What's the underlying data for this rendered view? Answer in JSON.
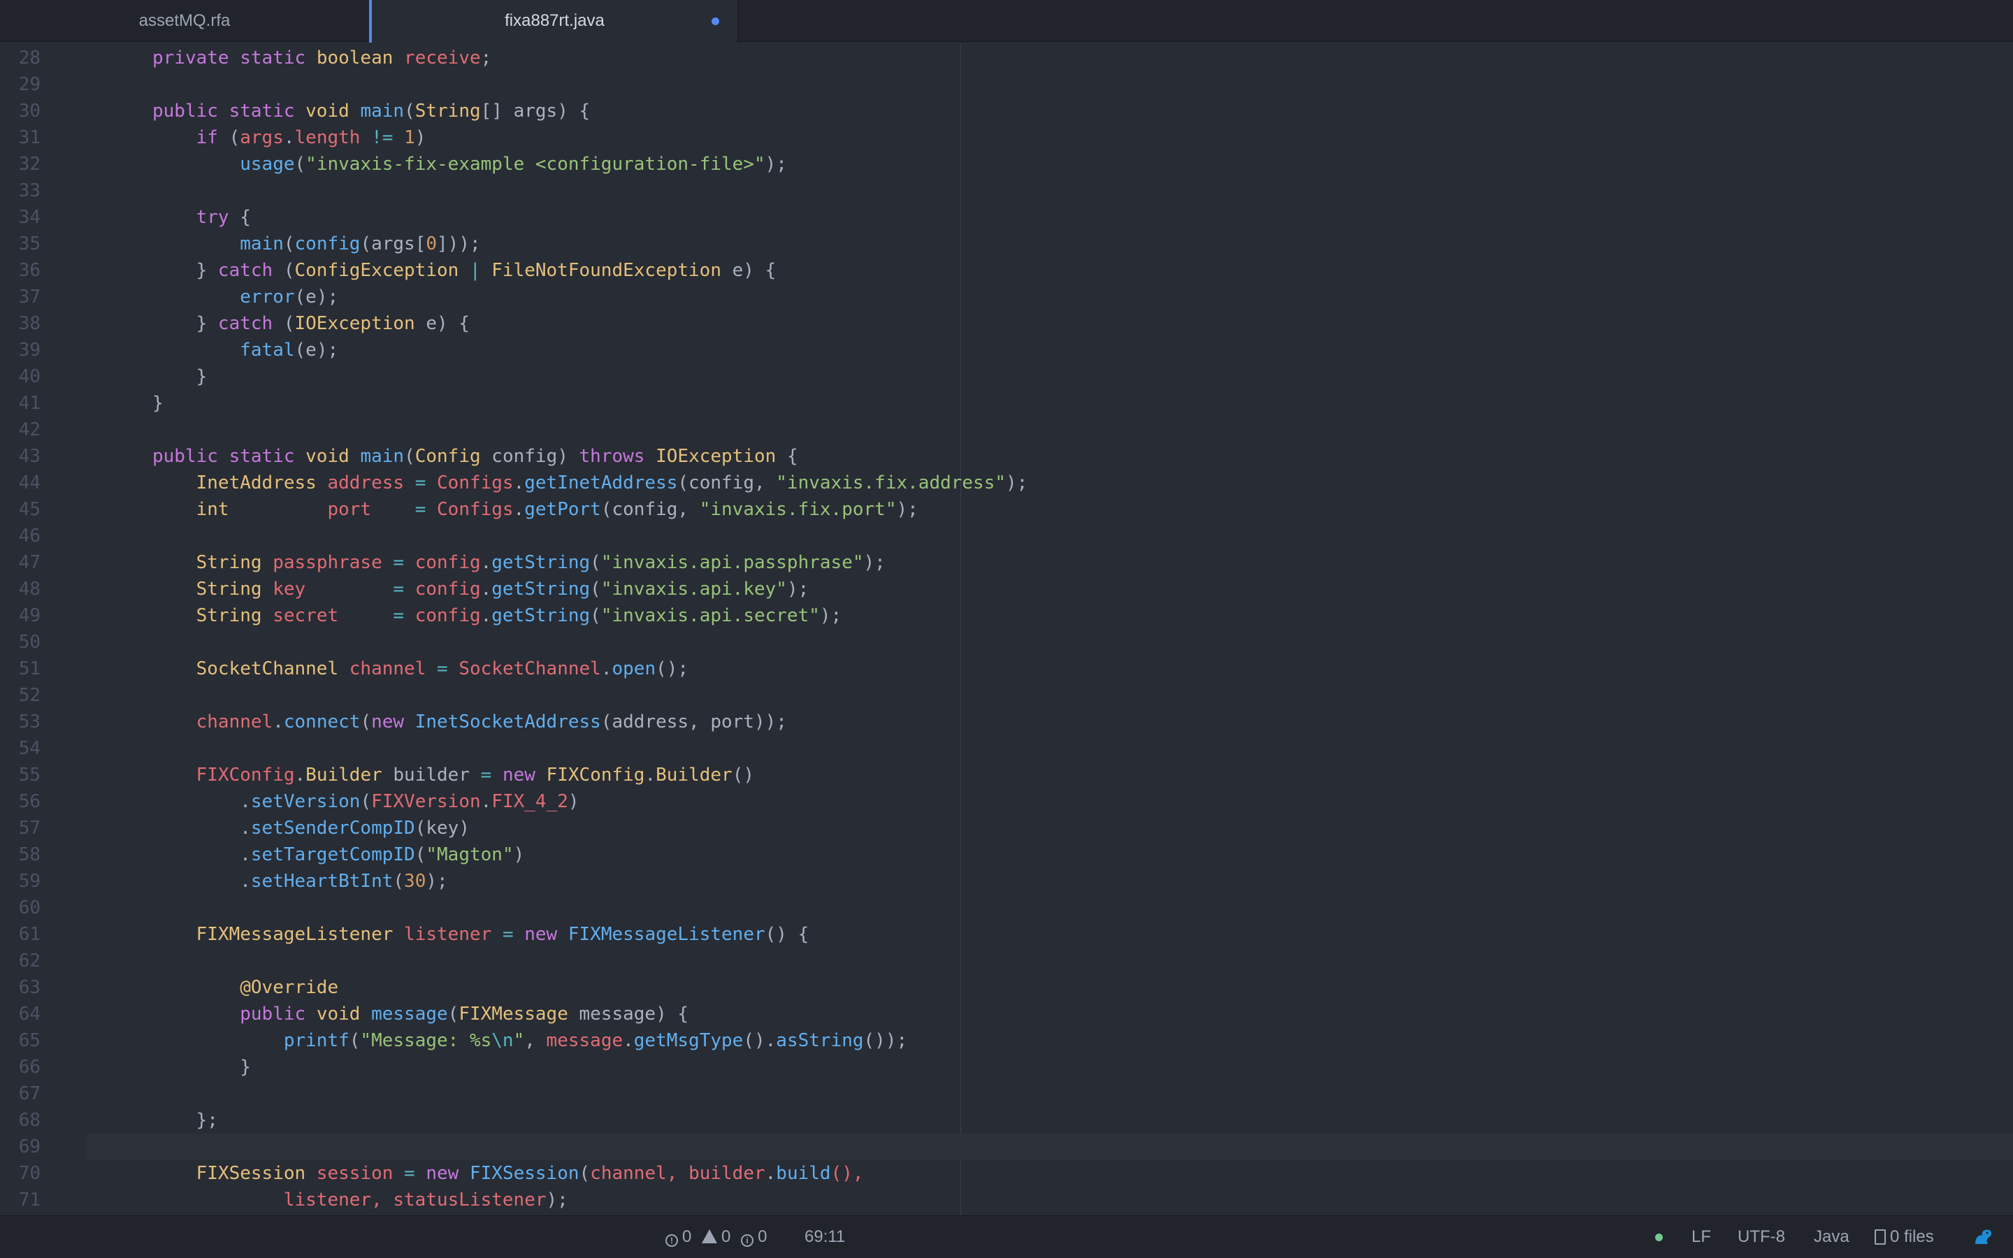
{
  "tabs": [
    {
      "label": "assetMQ.rfa",
      "active": false
    },
    {
      "label": "fixa887rt.java",
      "active": true,
      "modified": true
    }
  ],
  "editor": {
    "cursor_line": 69,
    "lines": [
      {
        "n": "28",
        "t": [
          [
            "",
            "private static boolean receive;",
            "mixed"
          ]
        ]
      },
      {
        "n": "29"
      },
      {
        "n": "30"
      },
      {
        "n": "31"
      },
      {
        "n": "32"
      },
      {
        "n": "33"
      },
      {
        "n": "34"
      },
      {
        "n": "35"
      },
      {
        "n": "36"
      },
      {
        "n": "37"
      },
      {
        "n": "38"
      },
      {
        "n": "39"
      },
      {
        "n": "40"
      },
      {
        "n": "41"
      },
      {
        "n": "42"
      },
      {
        "n": "43"
      },
      {
        "n": "44"
      },
      {
        "n": "45"
      },
      {
        "n": "46"
      },
      {
        "n": "47"
      },
      {
        "n": "48"
      },
      {
        "n": "49"
      },
      {
        "n": "50"
      },
      {
        "n": "51"
      },
      {
        "n": "52"
      },
      {
        "n": "53"
      },
      {
        "n": "54"
      },
      {
        "n": "55"
      },
      {
        "n": "56"
      },
      {
        "n": "57"
      },
      {
        "n": "58"
      },
      {
        "n": "59"
      },
      {
        "n": "60"
      },
      {
        "n": "61"
      },
      {
        "n": "62"
      },
      {
        "n": "63"
      },
      {
        "n": "64"
      },
      {
        "n": "65"
      },
      {
        "n": "66"
      },
      {
        "n": "67"
      },
      {
        "n": "68"
      },
      {
        "n": "69"
      },
      {
        "n": "70"
      },
      {
        "n": "71"
      }
    ],
    "code": [
      [
        [
          "kw",
          "private "
        ],
        [
          "kw",
          "static "
        ],
        [
          "ty",
          "boolean "
        ],
        [
          "va",
          "receive"
        ],
        [
          "pl",
          ";"
        ]
      ],
      [],
      [
        [
          "kw",
          "public "
        ],
        [
          "kw",
          "static "
        ],
        [
          "ty",
          "void "
        ],
        [
          "fn",
          "main"
        ],
        [
          "pl",
          "("
        ],
        [
          "ty",
          "String"
        ],
        [
          "pl",
          "[] args) {"
        ]
      ],
      [
        [
          "pl",
          "    "
        ],
        [
          "kw",
          "if "
        ],
        [
          "pl",
          "("
        ],
        [
          "va",
          "args"
        ],
        [
          "pl",
          "."
        ],
        [
          "va",
          "length "
        ],
        [
          "op",
          "!= "
        ],
        [
          "nu",
          "1"
        ],
        [
          "pl",
          ")"
        ]
      ],
      [
        [
          "pl",
          "        "
        ],
        [
          "fn",
          "usage"
        ],
        [
          "pl",
          "("
        ],
        [
          "st",
          "\"invaxis-fix-example <configuration-file>\""
        ],
        [
          "pl",
          ");"
        ]
      ],
      [],
      [
        [
          "pl",
          "    "
        ],
        [
          "kw",
          "try "
        ],
        [
          "pl",
          "{"
        ]
      ],
      [
        [
          "pl",
          "        "
        ],
        [
          "fn",
          "main"
        ],
        [
          "pl",
          "("
        ],
        [
          "fn",
          "config"
        ],
        [
          "pl",
          "(args["
        ],
        [
          "nu",
          "0"
        ],
        [
          "pl",
          "]));"
        ]
      ],
      [
        [
          "pl",
          "    } "
        ],
        [
          "kw",
          "catch "
        ],
        [
          "pl",
          "("
        ],
        [
          "ty",
          "ConfigException "
        ],
        [
          "op",
          "| "
        ],
        [
          "ty",
          "FileNotFoundException "
        ],
        [
          "pl",
          "e) {"
        ]
      ],
      [
        [
          "pl",
          "        "
        ],
        [
          "fn",
          "error"
        ],
        [
          "pl",
          "(e);"
        ]
      ],
      [
        [
          "pl",
          "    } "
        ],
        [
          "kw",
          "catch "
        ],
        [
          "pl",
          "("
        ],
        [
          "ty",
          "IOException "
        ],
        [
          "pl",
          "e) {"
        ]
      ],
      [
        [
          "pl",
          "        "
        ],
        [
          "fn",
          "fatal"
        ],
        [
          "pl",
          "(e);"
        ]
      ],
      [
        [
          "pl",
          "    }"
        ]
      ],
      [
        [
          "pl",
          "}"
        ]
      ],
      [],
      [
        [
          "kw",
          "public "
        ],
        [
          "kw",
          "static "
        ],
        [
          "ty",
          "void "
        ],
        [
          "fn",
          "main"
        ],
        [
          "pl",
          "("
        ],
        [
          "ty",
          "Config "
        ],
        [
          "pl",
          "config) "
        ],
        [
          "kw",
          "throws "
        ],
        [
          "ty",
          "IOException "
        ],
        [
          "pl",
          "{"
        ]
      ],
      [
        [
          "pl",
          "    "
        ],
        [
          "ty",
          "InetAddress "
        ],
        [
          "va",
          "address "
        ],
        [
          "op",
          "= "
        ],
        [
          "va",
          "Configs"
        ],
        [
          "pl",
          "."
        ],
        [
          "fn",
          "getInetAddress"
        ],
        [
          "pl",
          "(config, "
        ],
        [
          "st",
          "\"invaxis.fix.address\""
        ],
        [
          "pl",
          ");"
        ]
      ],
      [
        [
          "pl",
          "    "
        ],
        [
          "ty",
          "int         "
        ],
        [
          "va",
          "port    "
        ],
        [
          "op",
          "= "
        ],
        [
          "va",
          "Configs"
        ],
        [
          "pl",
          "."
        ],
        [
          "fn",
          "getPort"
        ],
        [
          "pl",
          "(config, "
        ],
        [
          "st",
          "\"invaxis.fix.port\""
        ],
        [
          "pl",
          ");"
        ]
      ],
      [],
      [
        [
          "pl",
          "    "
        ],
        [
          "ty",
          "String "
        ],
        [
          "va",
          "passphrase "
        ],
        [
          "op",
          "= "
        ],
        [
          "va",
          "config"
        ],
        [
          "pl",
          "."
        ],
        [
          "fn",
          "getString"
        ],
        [
          "pl",
          "("
        ],
        [
          "st",
          "\"invaxis.api.passphrase\""
        ],
        [
          "pl",
          ");"
        ]
      ],
      [
        [
          "pl",
          "    "
        ],
        [
          "ty",
          "String "
        ],
        [
          "va",
          "key        "
        ],
        [
          "op",
          "= "
        ],
        [
          "va",
          "config"
        ],
        [
          "pl",
          "."
        ],
        [
          "fn",
          "getString"
        ],
        [
          "pl",
          "("
        ],
        [
          "st",
          "\"invaxis.api.key\""
        ],
        [
          "pl",
          ");"
        ]
      ],
      [
        [
          "pl",
          "    "
        ],
        [
          "ty",
          "String "
        ],
        [
          "va",
          "secret     "
        ],
        [
          "op",
          "= "
        ],
        [
          "va",
          "config"
        ],
        [
          "pl",
          "."
        ],
        [
          "fn",
          "getString"
        ],
        [
          "pl",
          "("
        ],
        [
          "st",
          "\"invaxis.api.secret\""
        ],
        [
          "pl",
          ");"
        ]
      ],
      [],
      [
        [
          "pl",
          "    "
        ],
        [
          "ty",
          "SocketChannel "
        ],
        [
          "va",
          "channel "
        ],
        [
          "op",
          "= "
        ],
        [
          "va",
          "SocketChannel"
        ],
        [
          "pl",
          "."
        ],
        [
          "fn",
          "open"
        ],
        [
          "pl",
          "();"
        ]
      ],
      [],
      [
        [
          "pl",
          "    "
        ],
        [
          "va",
          "channel"
        ],
        [
          "pl",
          "."
        ],
        [
          "fn",
          "connect"
        ],
        [
          "pl",
          "("
        ],
        [
          "kw",
          "new "
        ],
        [
          "fn",
          "InetSocketAddress"
        ],
        [
          "pl",
          "(address, port));"
        ]
      ],
      [],
      [
        [
          "pl",
          "    "
        ],
        [
          "va",
          "FIXConfig"
        ],
        [
          "pl",
          "."
        ],
        [
          "ty",
          "Builder "
        ],
        [
          "pl",
          "builder "
        ],
        [
          "op",
          "= "
        ],
        [
          "kw",
          "new "
        ],
        [
          "ty",
          "FIXConfig"
        ],
        [
          "pl",
          "."
        ],
        [
          "ty",
          "Builder"
        ],
        [
          "pl",
          "()"
        ]
      ],
      [
        [
          "pl",
          "        ."
        ],
        [
          "fn",
          "setVersion"
        ],
        [
          "pl",
          "("
        ],
        [
          "va",
          "FIXVersion"
        ],
        [
          "pl",
          "."
        ],
        [
          "va",
          "FIX_4_2"
        ],
        [
          "pl",
          ")"
        ]
      ],
      [
        [
          "pl",
          "        ."
        ],
        [
          "fn",
          "setSenderCompID"
        ],
        [
          "pl",
          "(key)"
        ]
      ],
      [
        [
          "pl",
          "        ."
        ],
        [
          "fn",
          "setTargetCompID"
        ],
        [
          "pl",
          "("
        ],
        [
          "st",
          "\"Magton\""
        ],
        [
          "pl",
          ")"
        ]
      ],
      [
        [
          "pl",
          "        ."
        ],
        [
          "fn",
          "setHeartBtInt"
        ],
        [
          "pl",
          "("
        ],
        [
          "nu",
          "30"
        ],
        [
          "pl",
          ");"
        ]
      ],
      [],
      [
        [
          "pl",
          "    "
        ],
        [
          "ty",
          "FIXMessageListener "
        ],
        [
          "va",
          "listener "
        ],
        [
          "op",
          "= "
        ],
        [
          "kw",
          "new "
        ],
        [
          "fn",
          "FIXMessageListener"
        ],
        [
          "pl",
          "() {"
        ]
      ],
      [],
      [
        [
          "pl",
          "        "
        ],
        [
          "ty",
          "@Override"
        ]
      ],
      [
        [
          "pl",
          "        "
        ],
        [
          "kw",
          "public "
        ],
        [
          "ty",
          "void "
        ],
        [
          "fn",
          "message"
        ],
        [
          "pl",
          "("
        ],
        [
          "ty",
          "FIXMessage "
        ],
        [
          "pl",
          "message) {"
        ]
      ],
      [
        [
          "pl",
          "            "
        ],
        [
          "fn",
          "printf"
        ],
        [
          "pl",
          "("
        ],
        [
          "st",
          "\"Message: %s"
        ],
        [
          "op",
          "\\n"
        ],
        [
          "st",
          "\""
        ],
        [
          "pl",
          ", "
        ],
        [
          "va",
          "message"
        ],
        [
          "pl",
          "."
        ],
        [
          "fn",
          "getMsgType"
        ],
        [
          "pl",
          "()."
        ],
        [
          "fn",
          "asString"
        ],
        [
          "pl",
          "());"
        ]
      ],
      [
        [
          "pl",
          "        }"
        ]
      ],
      [],
      [
        [
          "pl",
          "    };"
        ]
      ],
      [],
      [
        [
          "pl",
          "    "
        ],
        [
          "ty",
          "FIXSession "
        ],
        [
          "va",
          "session "
        ],
        [
          "op",
          "= "
        ],
        [
          "kw",
          "new "
        ],
        [
          "fn",
          "FIXSession"
        ],
        [
          "pl",
          "("
        ],
        [
          "va",
          "channel, builder"
        ],
        [
          "pl",
          "."
        ],
        [
          "fn",
          "build"
        ],
        [
          "va",
          "(),"
        ]
      ],
      [
        [
          "va",
          "            listener, statusListener"
        ],
        [
          "pl",
          ");"
        ]
      ]
    ]
  },
  "status": {
    "errors": "0",
    "warnings": "0",
    "infos": "0",
    "cursor_position": "69:11",
    "line_ending": "LF",
    "encoding": "UTF-8",
    "grammar": "Java",
    "git_files": "0 files"
  },
  "colors": {
    "background": "#282c34",
    "accent": "#568af2",
    "keyword": "#c678dd",
    "type": "#e5c07b",
    "variable": "#e06c75",
    "function": "#61afef",
    "string": "#98c379",
    "number": "#d19a66"
  }
}
